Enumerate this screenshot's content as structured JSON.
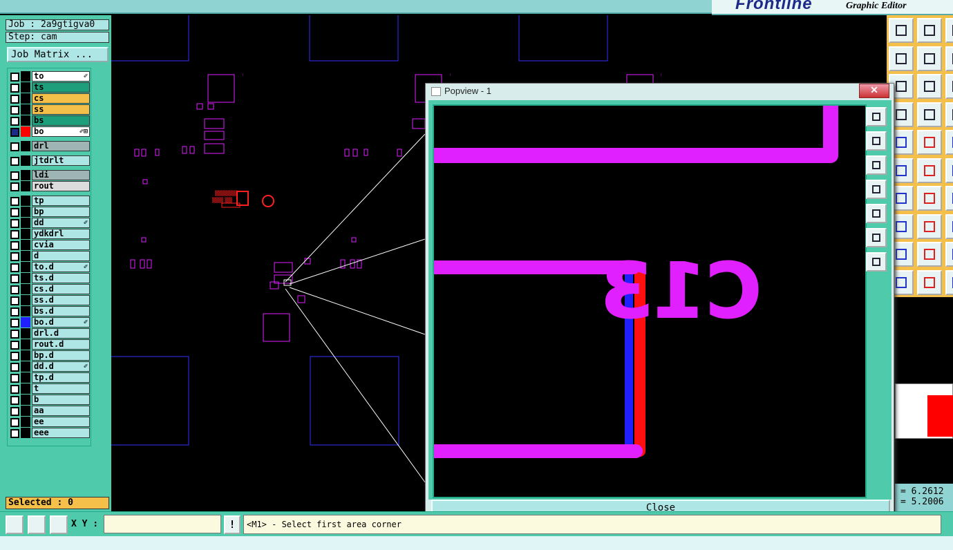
{
  "brand": {
    "logo": "Frontline",
    "subtitle": "Graphic Editor"
  },
  "job": {
    "job_line": "Job : 2a9gtigva0",
    "step_line": "Step: cam",
    "matrix_button": "Job Matrix ..."
  },
  "layers": [
    {
      "name": "to",
      "bg": "#ffffff",
      "mark": "✐"
    },
    {
      "name": "ts",
      "bg": "#1e9e7a",
      "mark": ""
    },
    {
      "name": "cs",
      "bg": "#f5c04a",
      "mark": ""
    },
    {
      "name": "ss",
      "bg": "#f5c04a",
      "mark": ""
    },
    {
      "name": "bs",
      "bg": "#1e9e7a",
      "mark": ""
    },
    {
      "name": "bo",
      "bg": "#ffffff",
      "mark": "✐⊞",
      "color": "#ff0000",
      "checked": true
    },
    {
      "name": "drl",
      "bg": "#9fb4b4",
      "mark": "",
      "gap": true
    },
    {
      "name": "jtdrlt",
      "bg": "#aee6e6",
      "mark": "",
      "gap": true
    },
    {
      "name": "ldi",
      "bg": "#9fb4b4",
      "mark": "",
      "gap": true
    },
    {
      "name": "rout",
      "bg": "#dcdcdc",
      "mark": ""
    },
    {
      "name": "tp",
      "bg": "#aee6e6",
      "mark": "",
      "gap": true
    },
    {
      "name": "bp",
      "bg": "#aee6e6",
      "mark": ""
    },
    {
      "name": "dd",
      "bg": "#aee6e6",
      "mark": "✐"
    },
    {
      "name": "ydkdrl",
      "bg": "#aee6e6",
      "mark": ""
    },
    {
      "name": "cvia",
      "bg": "#aee6e6",
      "mark": ""
    },
    {
      "name": "d",
      "bg": "#aee6e6",
      "mark": ""
    },
    {
      "name": "to.d",
      "bg": "#aee6e6",
      "mark": "✐"
    },
    {
      "name": "ts.d",
      "bg": "#aee6e6",
      "mark": ""
    },
    {
      "name": "cs.d",
      "bg": "#aee6e6",
      "mark": ""
    },
    {
      "name": "ss.d",
      "bg": "#aee6e6",
      "mark": ""
    },
    {
      "name": "bs.d",
      "bg": "#aee6e6",
      "mark": ""
    },
    {
      "name": "bo.d",
      "bg": "#aee6e6",
      "mark": "✐",
      "color": "#2020ff"
    },
    {
      "name": "drl.d",
      "bg": "#aee6e6",
      "mark": ""
    },
    {
      "name": "rout.d",
      "bg": "#aee6e6",
      "mark": ""
    },
    {
      "name": "bp.d",
      "bg": "#aee6e6",
      "mark": ""
    },
    {
      "name": "dd.d",
      "bg": "#aee6e6",
      "mark": "✐"
    },
    {
      "name": "tp.d",
      "bg": "#aee6e6",
      "mark": ""
    },
    {
      "name": "t",
      "bg": "#aee6e6",
      "mark": ""
    },
    {
      "name": "b",
      "bg": "#aee6e6",
      "mark": ""
    },
    {
      "name": "aa",
      "bg": "#aee6e6",
      "mark": ""
    },
    {
      "name": "ee",
      "bg": "#aee6e6",
      "mark": ""
    },
    {
      "name": "eee",
      "bg": "#aee6e6",
      "mark": ""
    }
  ],
  "selected_label": "Selected : 0",
  "popup": {
    "title": "Popview - 1",
    "close_x": "✕",
    "close_button": "Close",
    "silk_text": "C13"
  },
  "coords": {
    "x": "= 6.2612",
    "y": "= 5.2006"
  },
  "bottom": {
    "xy_label": "X Y :",
    "xy_value": "",
    "excl": "!",
    "status": "<M1> - Select first area corner"
  },
  "colors": {
    "panel": "#4fcbab",
    "field": "#aee6e6",
    "accent": "#f5c04a",
    "magenta": "#e020ff",
    "red": "#ff0000",
    "blue": "#2020ff"
  }
}
